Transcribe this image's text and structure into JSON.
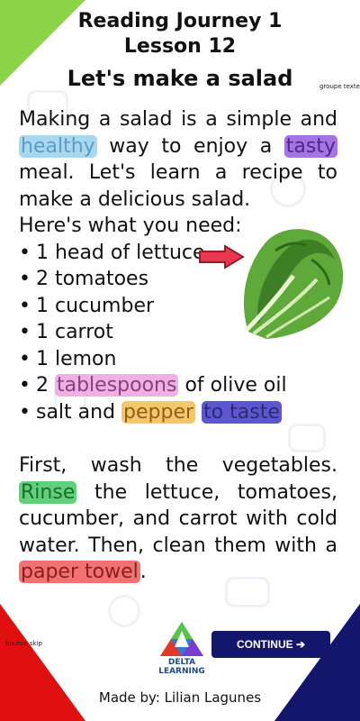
{
  "header": {
    "course": "Reading Journey 1",
    "lesson": "Lesson 12",
    "title": "Let's make a salad"
  },
  "labels": {
    "group_text": "groupe texte",
    "skip_button": "bouton skip"
  },
  "paragraph1": {
    "p1": "Making a salad is a simple and ",
    "w1": "healthy",
    "p2": " way to enjoy a ",
    "w2": "tasty",
    "p3": " meal. Let's learn a recipe to make a delicious salad."
  },
  "need_text": "Here's what you need:",
  "ingredients": {
    "i1": "1 head of lettuce",
    "i2": "2 tomatoes",
    "i3": "1 cucumber",
    "i4": "1 carrot",
    "i5": "1 lemon",
    "i6_pre": "2 ",
    "i6_word": "tablespoons",
    "i6_post": " of olive oil",
    "i7_pre": "salt and ",
    "i7_word1": "pepper",
    "i7_sep": " ",
    "i7_word2": "to taste"
  },
  "paragraph2": {
    "p1": "First, wash the vegetables. ",
    "w1": "Rinse",
    "p2": " the lettuce, tomatoes, cucumber, and carrot with cold water. Then, clean them with a ",
    "w2": "paper towel",
    "p3": "."
  },
  "logo": {
    "line1": "DELTA",
    "line2": "LEARNING"
  },
  "continue": {
    "label": "CONTINUE ➔"
  },
  "footer": {
    "credit": "Made by: Lilian Lagunes"
  },
  "colors": {
    "corner_tl": "#8bd44a",
    "corner_bl": "#e01010",
    "corner_br": "#14166b",
    "button": "#14166b"
  }
}
